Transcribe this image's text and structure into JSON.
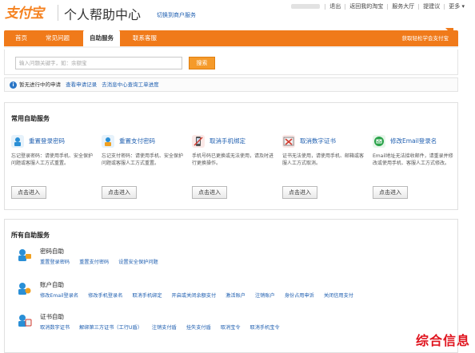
{
  "header": {
    "logo_text": "支付宝",
    "title": "个人帮助中心",
    "switch_link": "切换到商户服务",
    "top_nav": [
      "退出",
      "返回我的淘宝",
      "服务大厅",
      "提建议",
      "更多"
    ]
  },
  "navbar": {
    "tabs": [
      "首页",
      "常见问题",
      "自助服务",
      "联系客服"
    ],
    "active_tab": "自助服务",
    "right_link": "获取轻松学会支付宝"
  },
  "search": {
    "placeholder": "输入问题关键字，如：余额宝",
    "button_label": "搜索"
  },
  "notice": {
    "text": "暂无进行中的申请",
    "link_records": "查看申请记录",
    "link_progress": "去消息中心查询工单进度"
  },
  "common": {
    "title": "常用自助服务",
    "items": [
      {
        "title": "重置登录密码",
        "desc": "忘记登录密码：请使用手机、安全保护问题或客服人工方式重置。",
        "button": "点击进入",
        "icon": "login-password-icon",
        "color": "#2a8fd6"
      },
      {
        "title": "重置支付密码",
        "desc": "忘记支付密码：请使用手机、安全保护问题或客服人工方式重置。",
        "button": "点击进入",
        "icon": "pay-password-icon",
        "color": "#2a8fd6"
      },
      {
        "title": "取消手机绑定",
        "desc": "手机号码已更换或无法使用，请及时进行更换操作。",
        "button": "点击进入",
        "icon": "mobile-unbind-icon",
        "color": "#d23a2e"
      },
      {
        "title": "取消数字证书",
        "desc": "证书无法使用，请使用手机、邮箱或客服人工方式取消。",
        "button": "点击进入",
        "icon": "certificate-icon",
        "color": "#d23a2e"
      },
      {
        "title": "修改Email登录名",
        "desc": "Email地址无法接收邮件，请重录并修改或使用手机、客服人工方式修改。",
        "button": "点击进入",
        "icon": "email-icon",
        "color": "#2aa34a"
      }
    ]
  },
  "all_services": {
    "title": "所有自助服务",
    "groups": [
      {
        "title": "密码自助",
        "icon": "password-group-icon",
        "links": [
          "重置登录密码",
          "重置支付密码",
          "设置安全保护问题"
        ]
      },
      {
        "title": "账户自助",
        "icon": "account-group-icon",
        "links": [
          "修改Email登录名",
          "修改手机登录名",
          "取消手机绑定",
          "开启或关闭余额支付",
          "激活账户",
          "注销账户",
          "身份占用申诉",
          "关闭信用支付"
        ]
      },
      {
        "title": "证书自助",
        "icon": "certificate-group-icon",
        "links": [
          "取消数字证书",
          "解绑第三方证书（工行U盾）",
          "注销支付盾",
          "挂失支付盾",
          "取消宝令",
          "取消手机宝令"
        ]
      }
    ]
  },
  "watermark": "综合信息"
}
